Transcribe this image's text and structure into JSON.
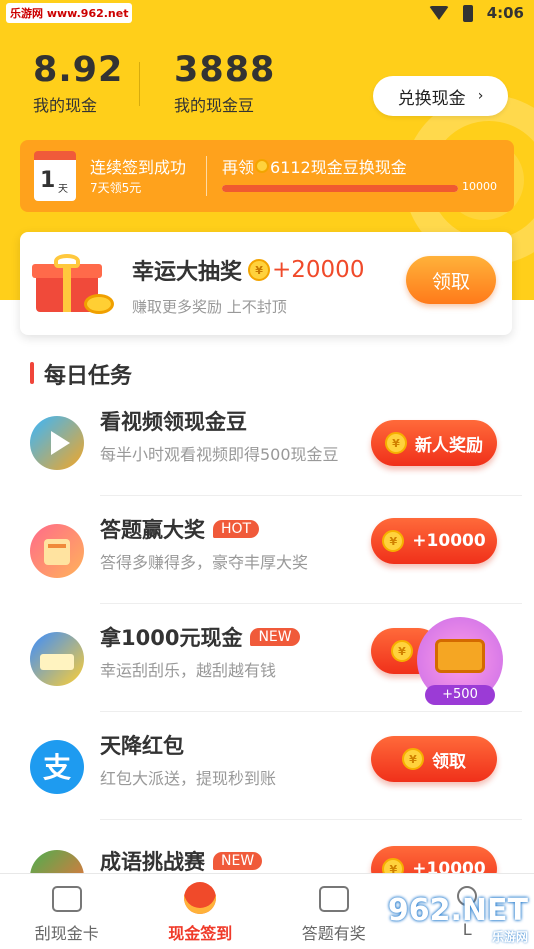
{
  "statusbar": {
    "site_badge": "乐游网 www.962.net",
    "time": "4:06"
  },
  "account": {
    "cash_value": "8.92",
    "cash_label": "我的现金",
    "beans_value": "3888",
    "beans_label": "我的现金豆",
    "exchange_label": "兑换现金",
    "exchange_chevron": "›"
  },
  "checkin": {
    "day_number": "1",
    "day_unit": "天",
    "title": "连续签到成功",
    "subtitle": "7天领5元",
    "redeem_prefix": "再领",
    "redeem_amount": "6112现金豆换现金",
    "progress_max_label": "10000",
    "progress_fraction": 0.999
  },
  "lottery": {
    "title": "幸运大抽奖",
    "amount": "+20000",
    "subtitle": "赚取更多奖励 上不封顶",
    "button": "领取"
  },
  "daily": {
    "section_title": "每日任务",
    "tasks": [
      {
        "title": "看视频领现金豆",
        "tag": "",
        "subtitle": "每半小时观看视频即得500现金豆",
        "button": "新人奖励"
      },
      {
        "title": "答题赢大奖",
        "tag": "HOT",
        "subtitle": "答得多赚得多，豪夺丰厚大奖",
        "button": "+10000"
      },
      {
        "title": "拿1000元现金",
        "tag": "NEW",
        "subtitle": "幸运刮刮乐，越刮越有钱",
        "button": ""
      },
      {
        "title": "天降红包",
        "tag": "",
        "subtitle": "红包大派送，提现秒到账",
        "button": "领取"
      },
      {
        "title": "成语挑战赛",
        "tag": "NEW",
        "subtitle": "",
        "button": "+10000"
      }
    ],
    "popup_bonus": "+500"
  },
  "tabs": [
    {
      "label": "刮现金卡"
    },
    {
      "label": "现金签到"
    },
    {
      "label": "答题有奖"
    },
    {
      "label": "L"
    }
  ],
  "watermark": {
    "main": "962.NET",
    "sub": "乐游网"
  },
  "colors": {
    "brand_yellow": "#ffcf1a",
    "accent_red": "#f03a2a",
    "orange": "#ffa21c"
  }
}
